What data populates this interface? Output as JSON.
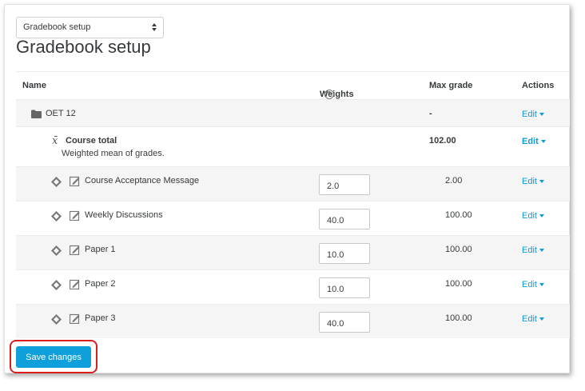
{
  "select": {
    "value": "Gradebook setup"
  },
  "page_title": "Gradebook setup",
  "columns": {
    "name": "Name",
    "weights": "Weights",
    "max_grade": "Max grade",
    "actions": "Actions"
  },
  "category": {
    "name": "OET 12",
    "max_grade": "-",
    "action": "Edit"
  },
  "course_total": {
    "name": "Course total",
    "description": "Weighted mean of grades.",
    "max_grade": "102.00",
    "action": "Edit"
  },
  "items": [
    {
      "name": "Course Acceptance Message",
      "weight": "2.0",
      "max_grade": "2.00",
      "action": "Edit"
    },
    {
      "name": "Weekly Discussions",
      "weight": "40.0",
      "max_grade": "100.00",
      "action": "Edit"
    },
    {
      "name": "Paper 1",
      "weight": "10.0",
      "max_grade": "100.00",
      "action": "Edit"
    },
    {
      "name": "Paper 2",
      "weight": "10.0",
      "max_grade": "100.00",
      "action": "Edit"
    },
    {
      "name": "Paper 3",
      "weight": "40.0",
      "max_grade": "100.00",
      "action": "Edit"
    }
  ],
  "save_label": "Save changes",
  "icons": {
    "help": "question-circle-icon",
    "folder": "folder-icon",
    "sum": "sigma-icon",
    "move": "move-icon",
    "assignment": "assignment-icon"
  },
  "colors": {
    "accent": "#0fa0dc",
    "link": "#0f9bd6",
    "highlight": "#d81e1e"
  }
}
